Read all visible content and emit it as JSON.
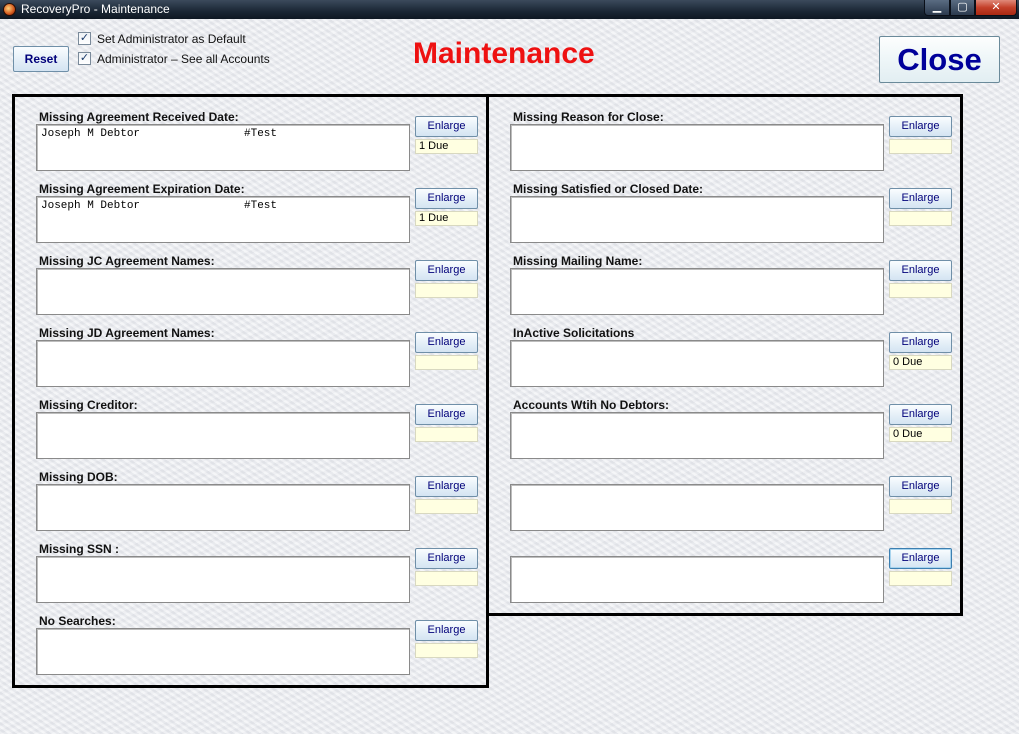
{
  "window": {
    "title": "RecoveryPro - Maintenance",
    "minimize_glyph": "▁",
    "maximize_glyph": "▢",
    "close_glyph": "✕"
  },
  "toolbar": {
    "reset_label": "Reset",
    "close_label": "Close",
    "page_title": "Maintenance",
    "check_default_label": "Set Administrator as Default",
    "check_default_checked": true,
    "check_all_label": "Administrator – See all Accounts",
    "check_all_checked": true,
    "check_glyph": "✓"
  },
  "enlarge_label": "Enlarge",
  "left_panels": [
    {
      "label": "Missing Agreement Received Date:",
      "due": "1 Due",
      "entries": [
        {
          "name": "Joseph M Debtor",
          "ref": "#Test"
        }
      ]
    },
    {
      "label": "Missing Agreement Expiration Date:",
      "due": "1 Due",
      "entries": [
        {
          "name": "Joseph M Debtor",
          "ref": "#Test"
        }
      ]
    },
    {
      "label": "Missing JC Agreement Names:",
      "due": "",
      "entries": []
    },
    {
      "label": "Missing JD Agreement Names:",
      "due": "",
      "entries": []
    },
    {
      "label": "Missing Creditor:",
      "due": "",
      "entries": []
    },
    {
      "label": "Missing DOB:",
      "due": "",
      "entries": []
    },
    {
      "label": "Missing SSN :",
      "due": "",
      "entries": []
    },
    {
      "label": "No Searches:",
      "due": "",
      "entries": []
    }
  ],
  "right_panels": [
    {
      "label": "Missing Reason for Close:",
      "due": "",
      "entries": []
    },
    {
      "label": "Missing Satisfied or Closed Date:",
      "due": "",
      "entries": []
    },
    {
      "label": "Missing Mailing Name:",
      "due": "",
      "entries": []
    },
    {
      "label": "InActive Solicitations",
      "due": "0 Due",
      "entries": []
    },
    {
      "label": "Accounts Wtih No Debtors:",
      "due": "0 Due",
      "entries": []
    },
    {
      "label": "",
      "due": "",
      "entries": []
    },
    {
      "label": "",
      "due": "",
      "entries": [],
      "focused": true
    }
  ]
}
